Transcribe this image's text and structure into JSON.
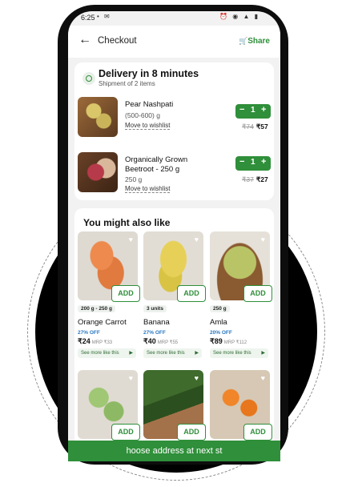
{
  "status": {
    "time": "6:25",
    "left_icons": "• ✉",
    "right_icons": "⏰ ◉ ▲ ▮"
  },
  "appbar": {
    "back_icon": "←",
    "title": "Checkout",
    "share_icon": "🛒",
    "share_label": "Share"
  },
  "delivery": {
    "title": "Delivery in 8 minutes",
    "subtitle": "Shipment of 2 items"
  },
  "cart_items": [
    {
      "name": "Pear Nashpati",
      "qty": "(500-600) g",
      "wishlist": "Move to wishlist",
      "count": "1",
      "mrp": "₹74",
      "price": "₹57"
    },
    {
      "name": "Organically Grown",
      "name2": "Beetroot - 250 g",
      "qty": "250 g",
      "wishlist": "Move to wishlist",
      "count": "1",
      "mrp": "₹37",
      "price": "₹27"
    }
  ],
  "stepper": {
    "minus": "−",
    "plus": "+"
  },
  "suggest": {
    "title": "You might also like",
    "add_label": "ADD",
    "more_label": "See more like this",
    "heart_icon": "♥",
    "products": [
      {
        "pill": "200 g - 250 g",
        "name": "Orange Carrot",
        "off": "27% OFF",
        "price": "₹24",
        "mrp": "MRP ₹33"
      },
      {
        "pill": "3 units",
        "name": "Banana",
        "off": "27% OFF",
        "price": "₹40",
        "mrp": "MRP ₹55"
      },
      {
        "pill": "250 g",
        "name": "Amla",
        "off": "20% OFF",
        "price": "₹89",
        "mrp": "MRP ₹112"
      }
    ]
  },
  "cta": {
    "label": "hoose address at next st"
  }
}
